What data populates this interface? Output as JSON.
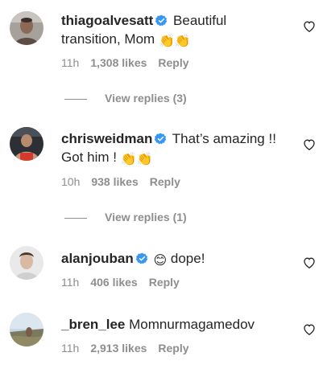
{
  "comments": [
    {
      "username": "thiagoalvesatt",
      "verified": true,
      "text": "Beautiful transition, Mom",
      "emoji": "👏👏",
      "time": "11h",
      "likes": "1,308 likes",
      "reply": "Reply",
      "view_replies": "View replies (3)"
    },
    {
      "username": "chrisweidman",
      "verified": true,
      "text": "That’s amazing !! Got him !",
      "emoji": "👏👏",
      "time": "10h",
      "likes": "938 likes",
      "reply": "Reply",
      "view_replies": "View replies (1)"
    },
    {
      "username": "alanjouban",
      "verified": true,
      "emoji": "😊",
      "text": "dope!",
      "time": "11h",
      "likes": "406 likes",
      "reply": "Reply"
    },
    {
      "username": "_bren_lee",
      "verified": false,
      "text": "Momnurmagamedov",
      "time": "11h",
      "likes": "2,913 likes",
      "reply": "Reply"
    }
  ],
  "icons": {
    "verified": "verified-badge-icon",
    "like": "heart-icon"
  },
  "colors": {
    "verified_blue": "#3897f0",
    "meta_gray": "#8e8e8e",
    "text": "#262626"
  }
}
